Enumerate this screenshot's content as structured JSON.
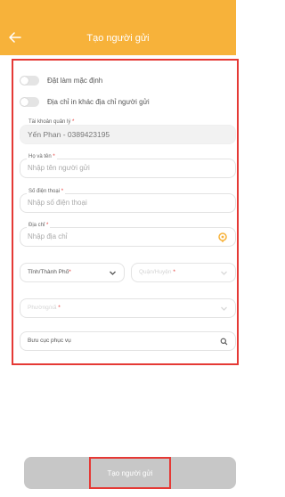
{
  "header": {
    "title": "Tạo người gửi",
    "back_icon": "arrow-left-icon",
    "color": "#f7b23a"
  },
  "toggles": [
    {
      "label": "Đặt làm mặc định"
    },
    {
      "label": "Địa chỉ in khác địa chỉ người gửi"
    }
  ],
  "fields": {
    "account": {
      "label": "Tài khoản quản lý",
      "required": "*",
      "value": "Yến Phan - 0389423195"
    },
    "name": {
      "label": "Họ và tên",
      "required": "*",
      "placeholder": "Nhập tên người gửi"
    },
    "phone": {
      "label": "Số điện thoại",
      "required": "*",
      "placeholder": "Nhập số điện thoại"
    },
    "address": {
      "label": "Địa chỉ",
      "required": "*",
      "placeholder": "Nhập địa chỉ",
      "icon": "location-pin-icon"
    }
  },
  "selects": {
    "province": {
      "label": "Tỉnh/Thành Phố",
      "required": "*"
    },
    "district": {
      "label": "Quận/Huyện",
      "required": "*"
    },
    "ward": {
      "label": "Phường/xã",
      "required": "*"
    },
    "post_office": {
      "label": "Bưu cục phục vụ",
      "icon": "search-icon"
    }
  },
  "submit": {
    "label": "Tạo người gửi"
  },
  "colors": {
    "accent": "#f7b23a",
    "required": "#e53935",
    "highlight": "#e53935"
  }
}
